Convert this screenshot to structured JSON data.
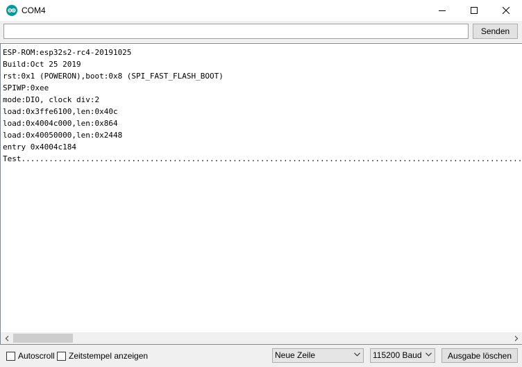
{
  "window": {
    "title": "COM4",
    "app_icon": "arduino-icon",
    "controls": [
      "minimize-icon",
      "maximize-icon",
      "close-icon"
    ]
  },
  "send_bar": {
    "input_value": "",
    "send_label": "Senden"
  },
  "output": {
    "lines": [
      "ESP-ROM:esp32s2-rc4-20191025",
      "Build:Oct 25 2019",
      "rst:0x1 (POWERON),boot:0x8 (SPI_FAST_FLASH_BOOT)",
      "SPIWP:0xee",
      "mode:DIO, clock div:2",
      "load:0x3ffe6100,len:0x40c",
      "load:0x4004c000,len:0x864",
      "load:0x40050000,len:0x2448",
      "entry 0x4004c184",
      "Test..................................................................................................................................................................."
    ]
  },
  "status_bar": {
    "autoscroll": {
      "label": "Autoscroll",
      "checked": false
    },
    "timestamp": {
      "label": "Zeitstempel anzeigen",
      "checked": false
    },
    "line_ending": {
      "selected": "Neue Zeile"
    },
    "baud_rate": {
      "selected": "115200 Baud"
    },
    "clear_label": "Ausgabe löschen"
  },
  "colors": {
    "accent": "#00979c",
    "toolbar_bg": "#f0f0f0"
  }
}
